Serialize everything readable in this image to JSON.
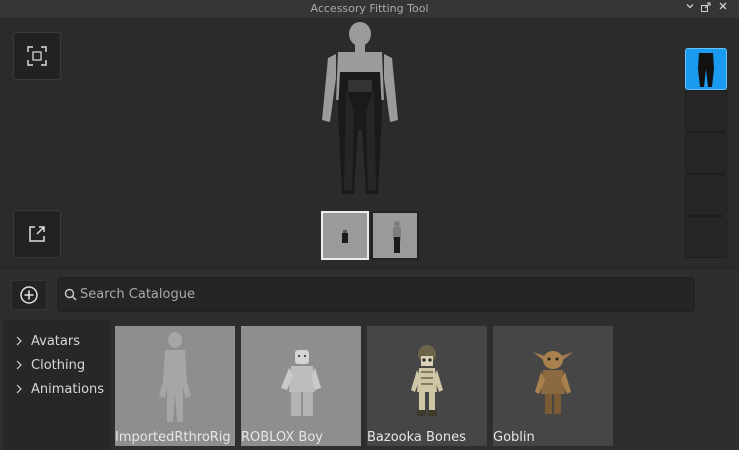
{
  "window": {
    "title": "Accessory Fitting Tool"
  },
  "search": {
    "placeholder": "Search Catalogue",
    "value": ""
  },
  "tree": {
    "items": [
      {
        "label": "Avatars"
      },
      {
        "label": "Clothing"
      },
      {
        "label": "Animations"
      }
    ]
  },
  "catalog": {
    "items": [
      {
        "label": "ImportedRthroRig"
      },
      {
        "label": "ROBLOX Boy"
      },
      {
        "label": "Bazooka Bones"
      },
      {
        "label": "Goblin"
      }
    ]
  },
  "colors": {
    "accent": "#1a9bf0",
    "background": "#2e2e2e",
    "panel": "#2b2b2b"
  }
}
